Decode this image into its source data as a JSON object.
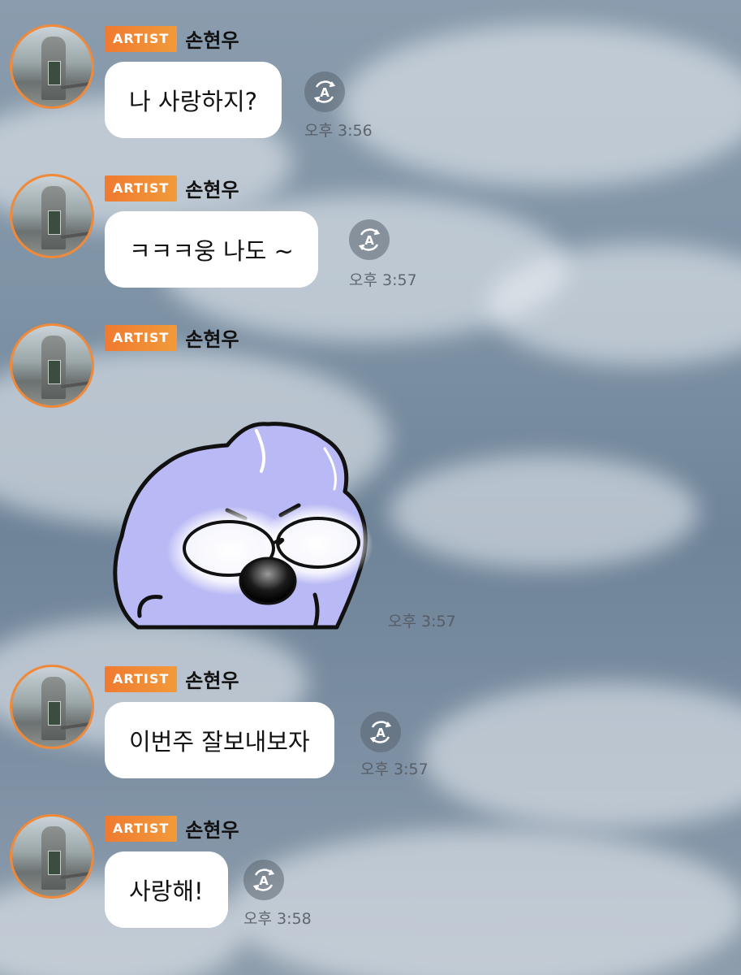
{
  "badge_label": "ARTIST",
  "sender_name": "손현우",
  "messages": [
    {
      "type": "text",
      "text": "나 사랑하지?",
      "time": "오후 3:56"
    },
    {
      "type": "text",
      "text": "ㅋㅋㅋ웅 나도 ~",
      "time": "오후 3:57"
    },
    {
      "type": "sticker",
      "sticker_icon": "sunglasses-bunny-sticker",
      "time": "오후 3:57"
    },
    {
      "type": "text",
      "text": "이번주 잘보내보자",
      "time": "오후 3:57"
    },
    {
      "type": "text",
      "text": "사랑해!",
      "time": "오후 3:58"
    }
  ],
  "translate_icon": "translate-icon",
  "colors": {
    "badge": "#f07a30",
    "avatar_ring": "#f08a3a",
    "bubble": "#ffffff",
    "sticker_body": "#b9b9f5"
  }
}
